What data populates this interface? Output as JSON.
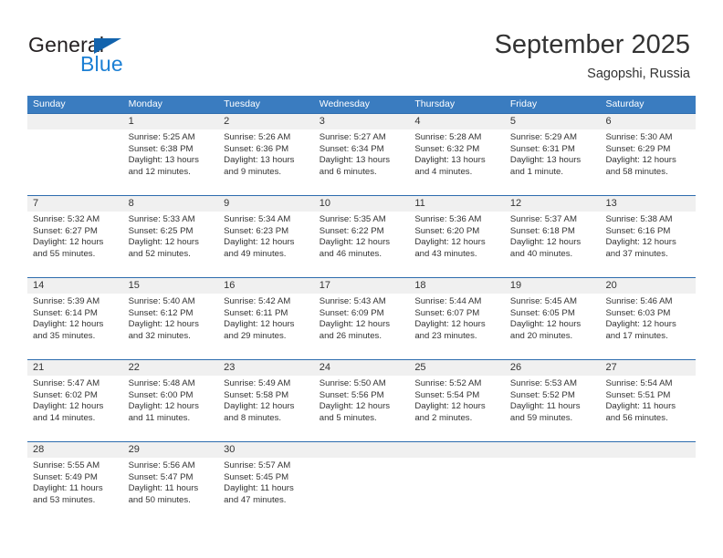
{
  "brand": {
    "name_part1": "General",
    "name_part2": "Blue",
    "logo_icon": "triangle-icon"
  },
  "header": {
    "title": "September 2025",
    "subtitle": "Sagopshi, Russia"
  },
  "calendar": {
    "weekdays": [
      "Sunday",
      "Monday",
      "Tuesday",
      "Wednesday",
      "Thursday",
      "Friday",
      "Saturday"
    ],
    "colors": {
      "header_bg": "#3a7cc0",
      "week_divider": "#2d6cae",
      "daynum_bg": "#f0f0f0",
      "brand_blue": "#1b7fd4",
      "logo_blue": "#1263ad"
    },
    "weeks": [
      {
        "days": [
          {
            "num": "",
            "sunrise": "",
            "sunset": "",
            "daylight1": "",
            "daylight2": ""
          },
          {
            "num": "1",
            "sunrise": "Sunrise: 5:25 AM",
            "sunset": "Sunset: 6:38 PM",
            "daylight1": "Daylight: 13 hours",
            "daylight2": "and 12 minutes."
          },
          {
            "num": "2",
            "sunrise": "Sunrise: 5:26 AM",
            "sunset": "Sunset: 6:36 PM",
            "daylight1": "Daylight: 13 hours",
            "daylight2": "and 9 minutes."
          },
          {
            "num": "3",
            "sunrise": "Sunrise: 5:27 AM",
            "sunset": "Sunset: 6:34 PM",
            "daylight1": "Daylight: 13 hours",
            "daylight2": "and 6 minutes."
          },
          {
            "num": "4",
            "sunrise": "Sunrise: 5:28 AM",
            "sunset": "Sunset: 6:32 PM",
            "daylight1": "Daylight: 13 hours",
            "daylight2": "and 4 minutes."
          },
          {
            "num": "5",
            "sunrise": "Sunrise: 5:29 AM",
            "sunset": "Sunset: 6:31 PM",
            "daylight1": "Daylight: 13 hours",
            "daylight2": "and 1 minute."
          },
          {
            "num": "6",
            "sunrise": "Sunrise: 5:30 AM",
            "sunset": "Sunset: 6:29 PM",
            "daylight1": "Daylight: 12 hours",
            "daylight2": "and 58 minutes."
          }
        ]
      },
      {
        "days": [
          {
            "num": "7",
            "sunrise": "Sunrise: 5:32 AM",
            "sunset": "Sunset: 6:27 PM",
            "daylight1": "Daylight: 12 hours",
            "daylight2": "and 55 minutes."
          },
          {
            "num": "8",
            "sunrise": "Sunrise: 5:33 AM",
            "sunset": "Sunset: 6:25 PM",
            "daylight1": "Daylight: 12 hours",
            "daylight2": "and 52 minutes."
          },
          {
            "num": "9",
            "sunrise": "Sunrise: 5:34 AM",
            "sunset": "Sunset: 6:23 PM",
            "daylight1": "Daylight: 12 hours",
            "daylight2": "and 49 minutes."
          },
          {
            "num": "10",
            "sunrise": "Sunrise: 5:35 AM",
            "sunset": "Sunset: 6:22 PM",
            "daylight1": "Daylight: 12 hours",
            "daylight2": "and 46 minutes."
          },
          {
            "num": "11",
            "sunrise": "Sunrise: 5:36 AM",
            "sunset": "Sunset: 6:20 PM",
            "daylight1": "Daylight: 12 hours",
            "daylight2": "and 43 minutes."
          },
          {
            "num": "12",
            "sunrise": "Sunrise: 5:37 AM",
            "sunset": "Sunset: 6:18 PM",
            "daylight1": "Daylight: 12 hours",
            "daylight2": "and 40 minutes."
          },
          {
            "num": "13",
            "sunrise": "Sunrise: 5:38 AM",
            "sunset": "Sunset: 6:16 PM",
            "daylight1": "Daylight: 12 hours",
            "daylight2": "and 37 minutes."
          }
        ]
      },
      {
        "days": [
          {
            "num": "14",
            "sunrise": "Sunrise: 5:39 AM",
            "sunset": "Sunset: 6:14 PM",
            "daylight1": "Daylight: 12 hours",
            "daylight2": "and 35 minutes."
          },
          {
            "num": "15",
            "sunrise": "Sunrise: 5:40 AM",
            "sunset": "Sunset: 6:12 PM",
            "daylight1": "Daylight: 12 hours",
            "daylight2": "and 32 minutes."
          },
          {
            "num": "16",
            "sunrise": "Sunrise: 5:42 AM",
            "sunset": "Sunset: 6:11 PM",
            "daylight1": "Daylight: 12 hours",
            "daylight2": "and 29 minutes."
          },
          {
            "num": "17",
            "sunrise": "Sunrise: 5:43 AM",
            "sunset": "Sunset: 6:09 PM",
            "daylight1": "Daylight: 12 hours",
            "daylight2": "and 26 minutes."
          },
          {
            "num": "18",
            "sunrise": "Sunrise: 5:44 AM",
            "sunset": "Sunset: 6:07 PM",
            "daylight1": "Daylight: 12 hours",
            "daylight2": "and 23 minutes."
          },
          {
            "num": "19",
            "sunrise": "Sunrise: 5:45 AM",
            "sunset": "Sunset: 6:05 PM",
            "daylight1": "Daylight: 12 hours",
            "daylight2": "and 20 minutes."
          },
          {
            "num": "20",
            "sunrise": "Sunrise: 5:46 AM",
            "sunset": "Sunset: 6:03 PM",
            "daylight1": "Daylight: 12 hours",
            "daylight2": "and 17 minutes."
          }
        ]
      },
      {
        "days": [
          {
            "num": "21",
            "sunrise": "Sunrise: 5:47 AM",
            "sunset": "Sunset: 6:02 PM",
            "daylight1": "Daylight: 12 hours",
            "daylight2": "and 14 minutes."
          },
          {
            "num": "22",
            "sunrise": "Sunrise: 5:48 AM",
            "sunset": "Sunset: 6:00 PM",
            "daylight1": "Daylight: 12 hours",
            "daylight2": "and 11 minutes."
          },
          {
            "num": "23",
            "sunrise": "Sunrise: 5:49 AM",
            "sunset": "Sunset: 5:58 PM",
            "daylight1": "Daylight: 12 hours",
            "daylight2": "and 8 minutes."
          },
          {
            "num": "24",
            "sunrise": "Sunrise: 5:50 AM",
            "sunset": "Sunset: 5:56 PM",
            "daylight1": "Daylight: 12 hours",
            "daylight2": "and 5 minutes."
          },
          {
            "num": "25",
            "sunrise": "Sunrise: 5:52 AM",
            "sunset": "Sunset: 5:54 PM",
            "daylight1": "Daylight: 12 hours",
            "daylight2": "and 2 minutes."
          },
          {
            "num": "26",
            "sunrise": "Sunrise: 5:53 AM",
            "sunset": "Sunset: 5:52 PM",
            "daylight1": "Daylight: 11 hours",
            "daylight2": "and 59 minutes."
          },
          {
            "num": "27",
            "sunrise": "Sunrise: 5:54 AM",
            "sunset": "Sunset: 5:51 PM",
            "daylight1": "Daylight: 11 hours",
            "daylight2": "and 56 minutes."
          }
        ]
      },
      {
        "days": [
          {
            "num": "28",
            "sunrise": "Sunrise: 5:55 AM",
            "sunset": "Sunset: 5:49 PM",
            "daylight1": "Daylight: 11 hours",
            "daylight2": "and 53 minutes."
          },
          {
            "num": "29",
            "sunrise": "Sunrise: 5:56 AM",
            "sunset": "Sunset: 5:47 PM",
            "daylight1": "Daylight: 11 hours",
            "daylight2": "and 50 minutes."
          },
          {
            "num": "30",
            "sunrise": "Sunrise: 5:57 AM",
            "sunset": "Sunset: 5:45 PM",
            "daylight1": "Daylight: 11 hours",
            "daylight2": "and 47 minutes."
          },
          {
            "num": "",
            "sunrise": "",
            "sunset": "",
            "daylight1": "",
            "daylight2": ""
          },
          {
            "num": "",
            "sunrise": "",
            "sunset": "",
            "daylight1": "",
            "daylight2": ""
          },
          {
            "num": "",
            "sunrise": "",
            "sunset": "",
            "daylight1": "",
            "daylight2": ""
          },
          {
            "num": "",
            "sunrise": "",
            "sunset": "",
            "daylight1": "",
            "daylight2": ""
          }
        ]
      }
    ]
  }
}
